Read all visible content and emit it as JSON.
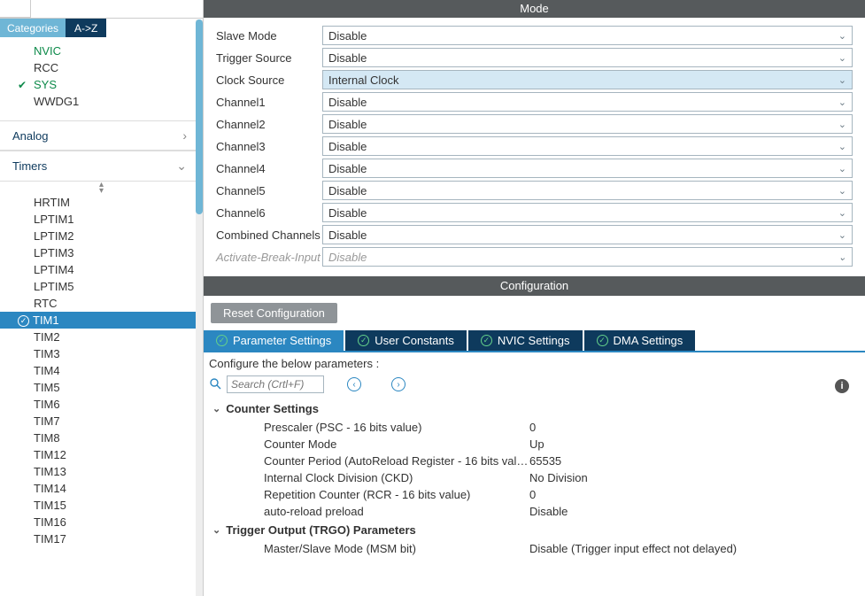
{
  "sidebar": {
    "tabs": {
      "categories": "Categories",
      "az": "A->Z"
    },
    "sections": {
      "core": [
        {
          "name": "NVIC",
          "check": false,
          "green": true
        },
        {
          "name": "RCC",
          "check": false
        },
        {
          "name": "SYS",
          "check": true,
          "green": true
        },
        {
          "name": "WWDG1",
          "check": false
        }
      ],
      "analog_label": "Analog",
      "timers_label": "Timers",
      "timers": [
        {
          "name": "HRTIM"
        },
        {
          "name": "LPTIM1"
        },
        {
          "name": "LPTIM2"
        },
        {
          "name": "LPTIM3"
        },
        {
          "name": "LPTIM4"
        },
        {
          "name": "LPTIM5"
        },
        {
          "name": "RTC"
        },
        {
          "name": "TIM1",
          "selected": true,
          "check": true
        },
        {
          "name": "TIM2"
        },
        {
          "name": "TIM3"
        },
        {
          "name": "TIM4"
        },
        {
          "name": "TIM5"
        },
        {
          "name": "TIM6"
        },
        {
          "name": "TIM7"
        },
        {
          "name": "TIM8"
        },
        {
          "name": "TIM12"
        },
        {
          "name": "TIM13"
        },
        {
          "name": "TIM14"
        },
        {
          "name": "TIM15"
        },
        {
          "name": "TIM16"
        },
        {
          "name": "TIM17"
        }
      ]
    }
  },
  "mode": {
    "header": "Mode",
    "rows": [
      {
        "label": "Slave Mode",
        "value": "Disable"
      },
      {
        "label": "Trigger Source",
        "value": "Disable"
      },
      {
        "label": "Clock Source",
        "value": "Internal Clock",
        "highlight": true
      },
      {
        "label": "Channel1",
        "value": "Disable"
      },
      {
        "label": "Channel2",
        "value": "Disable"
      },
      {
        "label": "Channel3",
        "value": "Disable"
      },
      {
        "label": "Channel4",
        "value": "Disable"
      },
      {
        "label": "Channel5",
        "value": "Disable"
      },
      {
        "label": "Channel6",
        "value": "Disable"
      },
      {
        "label": "Combined Channels",
        "value": "Disable"
      },
      {
        "label": "Activate-Break-Input",
        "value": "Disable",
        "disabled": true
      }
    ]
  },
  "config": {
    "header": "Configuration",
    "reset": "Reset Configuration",
    "tabs": [
      {
        "label": "Parameter Settings",
        "active": true
      },
      {
        "label": "User Constants"
      },
      {
        "label": "NVIC Settings"
      },
      {
        "label": "DMA Settings"
      }
    ],
    "note": "Configure the below parameters :",
    "search_placeholder": "Search (Crtl+F)",
    "groups": [
      {
        "title": "Counter Settings",
        "params": [
          {
            "k": "Prescaler (PSC - 16 bits value)",
            "v": "0"
          },
          {
            "k": "Counter Mode",
            "v": "Up"
          },
          {
            "k": "Counter Period (AutoReload Register - 16 bits val…",
            "v": "65535"
          },
          {
            "k": "Internal Clock Division (CKD)",
            "v": "No Division"
          },
          {
            "k": "Repetition Counter (RCR - 16 bits value)",
            "v": "0"
          },
          {
            "k": "auto-reload preload",
            "v": "Disable"
          }
        ]
      },
      {
        "title": "Trigger Output (TRGO) Parameters",
        "params": [
          {
            "k": "Master/Slave Mode (MSM bit)",
            "v": "Disable (Trigger input effect not delayed)"
          }
        ]
      }
    ]
  }
}
